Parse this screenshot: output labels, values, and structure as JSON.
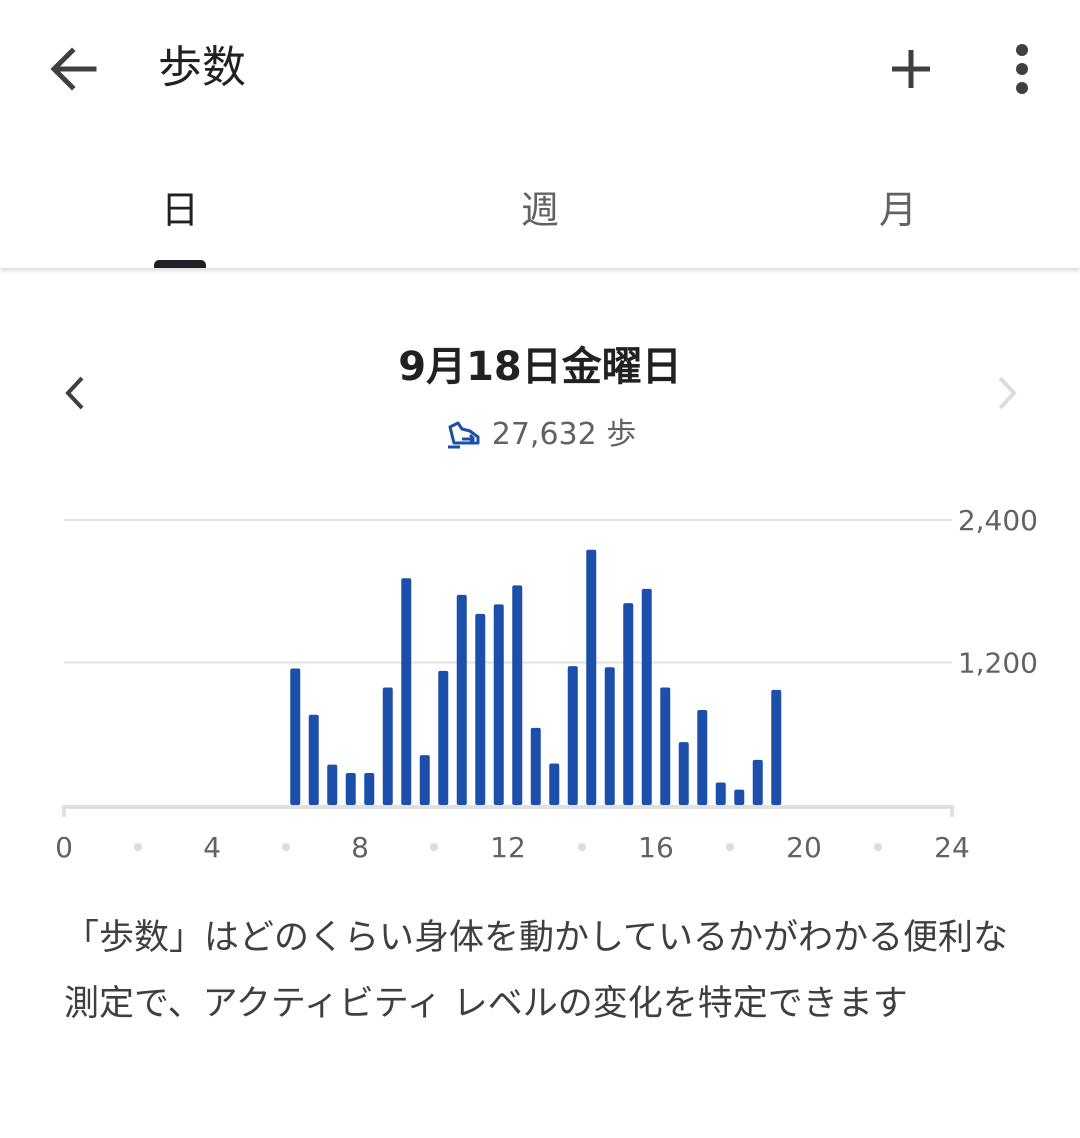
{
  "app_bar": {
    "title": "歩数",
    "back_icon": "arrow-left-icon",
    "add_icon": "plus-icon",
    "more_icon": "more-vert-icon"
  },
  "tabs": [
    {
      "label": "日",
      "active": true
    },
    {
      "label": "週",
      "active": false
    },
    {
      "label": "月",
      "active": false
    }
  ],
  "date_nav": {
    "date": "9月18日金曜日",
    "prev_icon": "chevron-left-icon",
    "next_icon": "chevron-right-icon",
    "next_enabled": false
  },
  "summary": {
    "steps_icon": "steps-shoe-icon",
    "steps_text": "27,632 歩"
  },
  "colors": {
    "bar": "#1b4faa",
    "grid": "#e3e3e3",
    "axis": "#e0e0e0"
  },
  "chart_data": {
    "type": "bar",
    "xlim": [
      0,
      24
    ],
    "ylim": [
      0,
      2400
    ],
    "x_ticks": [
      "0",
      "4",
      "8",
      "12",
      "16",
      "20",
      "24"
    ],
    "y_ticks": [
      "1,200",
      "2,400"
    ],
    "x": [
      6.25,
      6.75,
      7.25,
      7.75,
      8.25,
      8.75,
      9.25,
      9.75,
      10.25,
      10.75,
      11.25,
      11.75,
      12.25,
      12.75,
      13.25,
      13.75,
      14.25,
      14.75,
      15.25,
      15.75,
      16.25,
      16.75,
      17.25,
      17.75,
      18.25,
      18.75,
      19.25
    ],
    "values": [
      1150,
      760,
      340,
      270,
      270,
      990,
      1910,
      420,
      1130,
      1770,
      1610,
      1690,
      1850,
      650,
      350,
      1170,
      2150,
      1160,
      1700,
      1820,
      990,
      530,
      800,
      190,
      130,
      380,
      970
    ]
  },
  "description": "「歩数」はどのくらい身体を動かしているかがわかる便利な測定で、アクティビティ レベルの変化を特定できます"
}
